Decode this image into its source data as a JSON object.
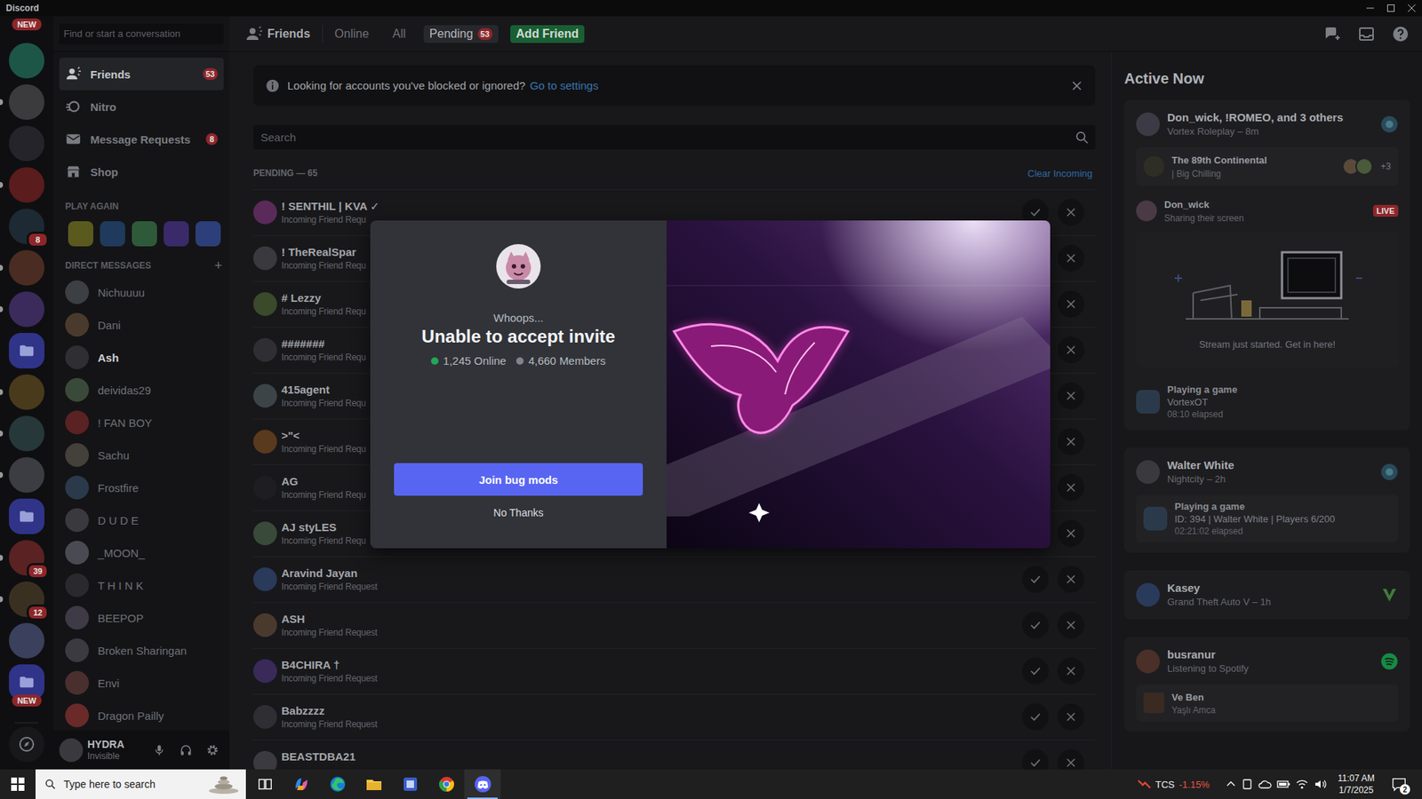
{
  "window": {
    "title": "Discord"
  },
  "rail_pills": {
    "top": "NEW",
    "bottom": "NEW"
  },
  "server_rail": [
    {
      "kind": "server",
      "badge": null,
      "unread": false
    },
    {
      "kind": "server",
      "badge": null,
      "unread": true
    },
    {
      "kind": "server",
      "badge": null,
      "unread": false
    },
    {
      "kind": "server",
      "badge": null,
      "unread": true
    },
    {
      "kind": "server",
      "badge": "8",
      "unread": false
    },
    {
      "kind": "server",
      "badge": null,
      "unread": true
    },
    {
      "kind": "server",
      "badge": null,
      "unread": true
    },
    {
      "kind": "folder",
      "badge": null,
      "unread": false
    },
    {
      "kind": "server",
      "badge": null,
      "unread": true
    },
    {
      "kind": "server",
      "badge": null,
      "unread": true
    },
    {
      "kind": "server",
      "badge": null,
      "unread": true
    },
    {
      "kind": "folder",
      "badge": null,
      "unread": false
    },
    {
      "kind": "server",
      "badge": "39",
      "unread": true
    },
    {
      "kind": "server",
      "badge": "12",
      "unread": true
    },
    {
      "kind": "server",
      "badge": null,
      "unread": false
    },
    {
      "kind": "folder",
      "badge": null,
      "unread": false
    }
  ],
  "sidebar": {
    "search_placeholder": "Find or start a conversation",
    "nav": [
      {
        "label": "Friends",
        "badge": "53",
        "selected": true
      },
      {
        "label": "Nitro",
        "badge": null,
        "selected": false
      },
      {
        "label": "Message Requests",
        "badge": "8",
        "selected": false
      },
      {
        "label": "Shop",
        "badge": null,
        "selected": false
      }
    ],
    "play_again_heading": "PLAY AGAIN",
    "dm_heading": "DIRECT MESSAGES",
    "dm_add": "+",
    "direct_messages": [
      {
        "name": "Nichuuuu",
        "unread": false
      },
      {
        "name": "Dani",
        "unread": false
      },
      {
        "name": "Ash",
        "unread": true
      },
      {
        "name": "deividas29",
        "unread": false
      },
      {
        "name": "! FAN BOY",
        "unread": false
      },
      {
        "name": "Sachu",
        "unread": false
      },
      {
        "name": "Frostfire",
        "unread": false
      },
      {
        "name": "D U D E",
        "unread": false
      },
      {
        "name": "_MOON_",
        "unread": false
      },
      {
        "name": "T H I N K",
        "unread": false
      },
      {
        "name": "BEEPOP",
        "unread": false
      },
      {
        "name": "Broken Sharingan",
        "unread": false
      },
      {
        "name": "Envi",
        "unread": false
      },
      {
        "name": "Dragon Pailly",
        "unread": false
      }
    ]
  },
  "user_panel": {
    "name": "HYDRA",
    "status": "Invisible"
  },
  "header": {
    "title": "Friends",
    "tabs": [
      {
        "label": "Online",
        "selected": false,
        "badge": null
      },
      {
        "label": "All",
        "selected": false,
        "badge": null
      },
      {
        "label": "Pending",
        "selected": true,
        "badge": "53"
      }
    ],
    "add_friend": "Add Friend"
  },
  "notice": {
    "text": "Looking for accounts you've blocked or ignored?",
    "link": "Go to settings"
  },
  "friends_search": {
    "placeholder": "Search"
  },
  "pending": {
    "label": "PENDING — 65",
    "clear_action": "Clear Incoming",
    "requests": [
      {
        "name": "! SENTHIL | KVA ✓",
        "subtitle": "Incoming Friend Requ"
      },
      {
        "name": "! TheRealSpar",
        "subtitle": "Incoming Friend Requ"
      },
      {
        "name": "# Lezzy",
        "subtitle": "Incoming Friend Requ"
      },
      {
        "name": "#######",
        "subtitle": "Incoming Friend Requ"
      },
      {
        "name": "415agent",
        "subtitle": "Incoming Friend Requ"
      },
      {
        "name": ">\"<",
        "subtitle": "Incoming Friend Requ"
      },
      {
        "name": "AG",
        "subtitle": "Incoming Friend Requ"
      },
      {
        "name": "AJ styLES",
        "subtitle": "Incoming Friend Requ"
      },
      {
        "name": "Aravind Jayan",
        "subtitle": "Incoming Friend Request"
      },
      {
        "name": "ASH",
        "subtitle": "Incoming Friend Request"
      },
      {
        "name": "B4CHIRA †",
        "subtitle": "Incoming Friend Request"
      },
      {
        "name": "Babzzzz",
        "subtitle": "Incoming Friend Request"
      },
      {
        "name": "BEASTDBA21",
        "subtitle": ""
      }
    ]
  },
  "active_now": {
    "heading": "Active Now",
    "cards": [
      {
        "kind": "group",
        "title": "Don_wick, !ROMEO, and 3 others",
        "subtitle": "Vortex Roleplay – 8m",
        "channel": {
          "title": "The 89th Continental",
          "subtitle": "| Big Chilling",
          "extra": "+3"
        },
        "stream": {
          "name": "Don_wick",
          "subtitle": "Sharing their screen",
          "badge": "LIVE",
          "caption": "Stream just started. Get in here!"
        },
        "activity": {
          "label": "Playing a game",
          "title": "VortexOT",
          "detail": "08:10 elapsed"
        }
      },
      {
        "kind": "game",
        "title": "Walter White",
        "subtitle": "Nightcity – 2h",
        "activity": {
          "label": "Playing a game",
          "title": "ID: 394 | Walter White | Players 6/200",
          "detail": "02:21:02 elapsed"
        }
      },
      {
        "kind": "simple",
        "title": "Kasey",
        "subtitle": "Grand Theft Auto V – 1h"
      },
      {
        "kind": "music",
        "title": "busranur",
        "subtitle": "Listening to Spotify",
        "track": {
          "title": "Ve Ben",
          "artist": "Yaşlı Amca"
        }
      }
    ]
  },
  "invite_modal": {
    "eyebrow": "Whoops...",
    "title": "Unable to accept invite",
    "online": "1,245 Online",
    "members": "4,660 Members",
    "join_button": "Join bug mods",
    "dismiss": "No Thanks"
  },
  "taskbar": {
    "search_placeholder": "Type here to search",
    "apps": [
      {
        "selected": false
      },
      {
        "selected": false
      },
      {
        "selected": false
      },
      {
        "selected": false
      },
      {
        "selected": false
      },
      {
        "selected": false
      },
      {
        "selected": true
      }
    ],
    "stock": {
      "ticker": "TCS",
      "change": "-1.15%"
    },
    "clock": {
      "time": "11:07 AM",
      "date": "1/7/2025"
    },
    "notifications": "2"
  }
}
